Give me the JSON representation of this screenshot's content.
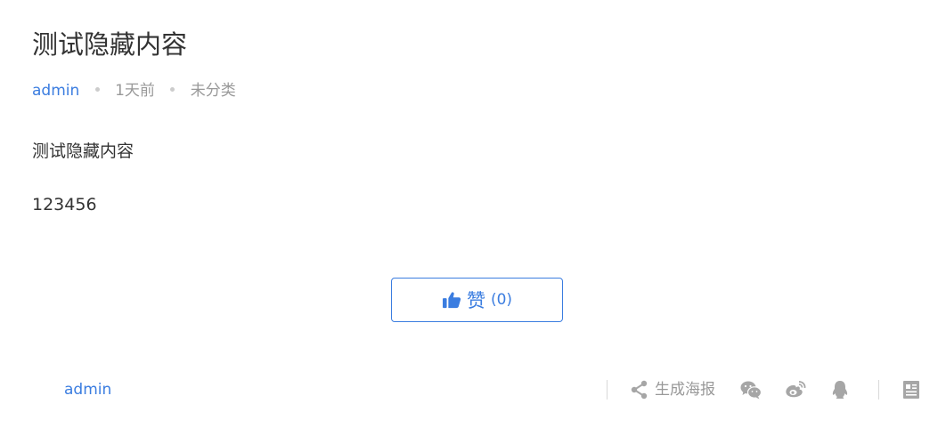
{
  "article": {
    "title": "测试隐藏内容",
    "author": "admin",
    "time": "1天前",
    "category": "未分类",
    "paragraphs": [
      "测试隐藏内容",
      "123456"
    ]
  },
  "like": {
    "label": "赞",
    "count": "(0)"
  },
  "footer": {
    "author": "admin",
    "poster_label": "生成海报",
    "share_icons": [
      "wechat-icon",
      "weibo-icon",
      "qq-icon"
    ],
    "extra_icon": "document-icon"
  },
  "colors": {
    "accent": "#3b7de0",
    "muted": "#999999",
    "text": "#333333",
    "icon": "#a6a6a6"
  }
}
